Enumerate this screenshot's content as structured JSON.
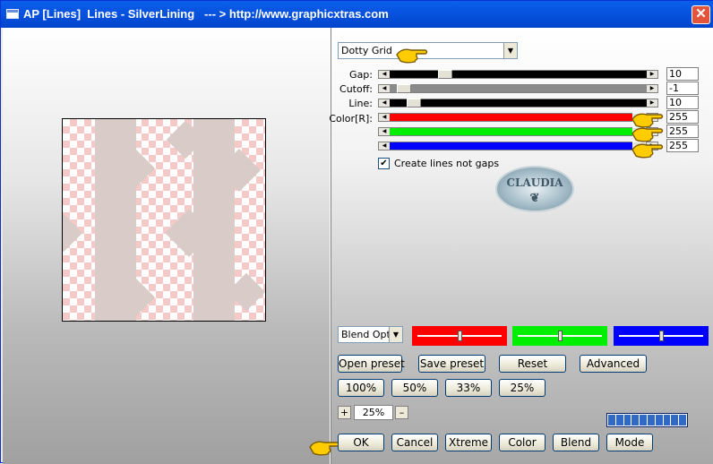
{
  "window": {
    "title": "AP [Lines]  Lines - SilverLining",
    "url_text": "--- > http://www.graphicxtras.com",
    "close_glyph": "✕"
  },
  "controls": {
    "preset_select": "Dotty Grid",
    "dropdown_glyph": "▼",
    "sliders": [
      {
        "label": "Gap:",
        "value": "10",
        "level": 0.2
      },
      {
        "label": "Cutoff:",
        "value": "-1",
        "level": 0.03
      },
      {
        "label": "Line:",
        "value": "10",
        "level": 0.07
      },
      {
        "label": "Color[R]:",
        "value": "255",
        "level": 1.0,
        "color": "#ff0000"
      },
      {
        "label": "",
        "value": "255",
        "level": 1.0,
        "color": "#00ee00"
      },
      {
        "label": "",
        "value": "255",
        "level": 1.0,
        "color": "#0000ff"
      }
    ],
    "checkbox": {
      "label": "Create lines not gaps",
      "checked": true,
      "mark": "✔"
    },
    "watermark": {
      "line1": "CLAUDIA",
      "line2": "❦"
    }
  },
  "blend": {
    "select": "Blend Optio",
    "colors": [
      {
        "color": "#ff0000",
        "level": 0.5
      },
      {
        "color": "#00ee00",
        "level": 0.5
      },
      {
        "color": "#0000ff",
        "level": 0.5
      }
    ]
  },
  "buttons": {
    "open_preset": "Open preset",
    "save_preset": "Save preset",
    "reset": "Reset",
    "advanced": "Advanced",
    "zoom100": "100%",
    "zoom50": "50%",
    "zoom33": "33%",
    "zoom25": "25%",
    "plus": "+",
    "minus": "–",
    "zoom_value": "25%",
    "ok": "OK",
    "cancel": "Cancel",
    "xtreme": "Xtreme",
    "color": "Color",
    "blend": "Blend",
    "mode": "Mode"
  },
  "colors": {
    "pointer": "#ffcc00",
    "checker": "#f6c9c9",
    "lines": "#d8cbc8"
  }
}
